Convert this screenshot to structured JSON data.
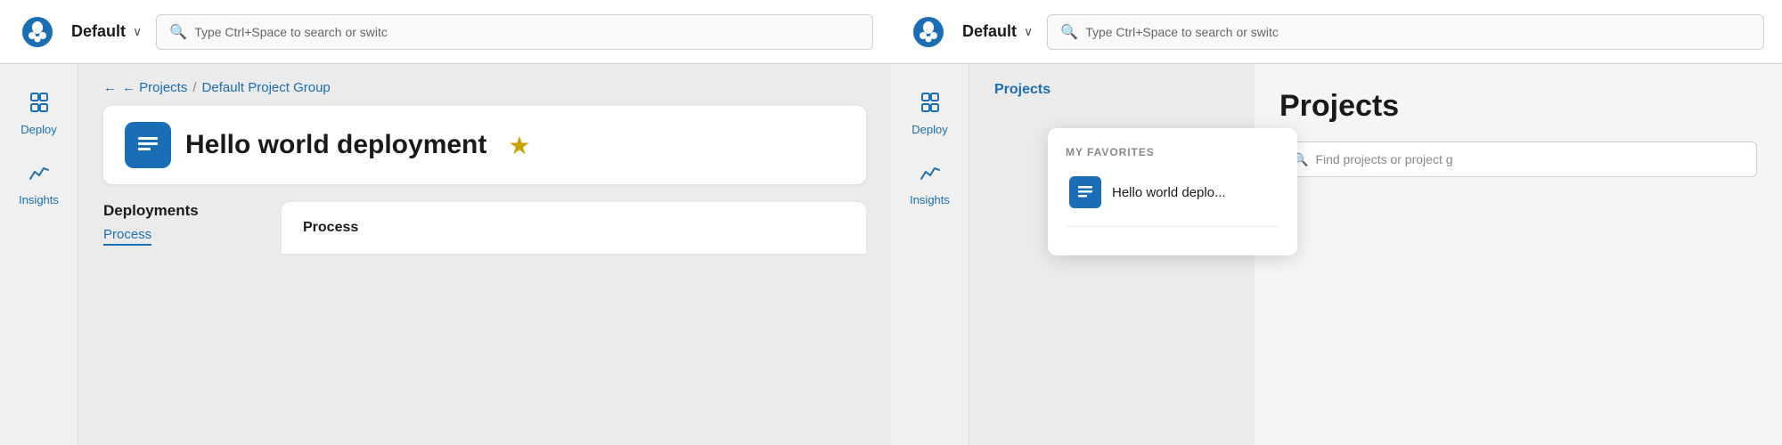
{
  "panel1": {
    "topbar": {
      "workspace": "Default",
      "search_placeholder": "Type Ctrl+Space to search or switc"
    },
    "sidebar": {
      "items": [
        {
          "id": "deploy",
          "label": "Deploy",
          "icon": "⇅"
        },
        {
          "id": "insights",
          "label": "Insights",
          "icon": "∿"
        }
      ]
    },
    "breadcrumb": {
      "back_label": "← Projects",
      "separator": "/",
      "current": "Default Project Group"
    },
    "project_card": {
      "title": "Hello world deployment",
      "icon": "≡",
      "star": "★"
    },
    "sections": {
      "left_title": "Deployments",
      "left_tab": "Process",
      "right_title": "Process"
    }
  },
  "panel2": {
    "topbar": {
      "workspace": "Default",
      "search_placeholder": "Type Ctrl+Space to search or switc"
    },
    "sidebar": {
      "items": [
        {
          "id": "deploy",
          "label": "Deploy",
          "icon": "⇅"
        },
        {
          "id": "insights",
          "label": "Insights",
          "icon": "∿"
        }
      ]
    },
    "breadcrumb": {
      "label": "Projects"
    },
    "dropdown": {
      "section_title": "MY FAVORITES",
      "items": [
        {
          "id": "hello-world",
          "label": "Hello world deplo...",
          "icon": "≡"
        }
      ]
    },
    "projects_section": {
      "title": "Projects",
      "search_placeholder": "Find projects or project g"
    }
  },
  "colors": {
    "accent": "#1a6eb5",
    "star": "#c9a000",
    "bg": "#e8e8e8",
    "topbar_bg": "#ffffff",
    "sidebar_bg": "#f0f0f0"
  }
}
